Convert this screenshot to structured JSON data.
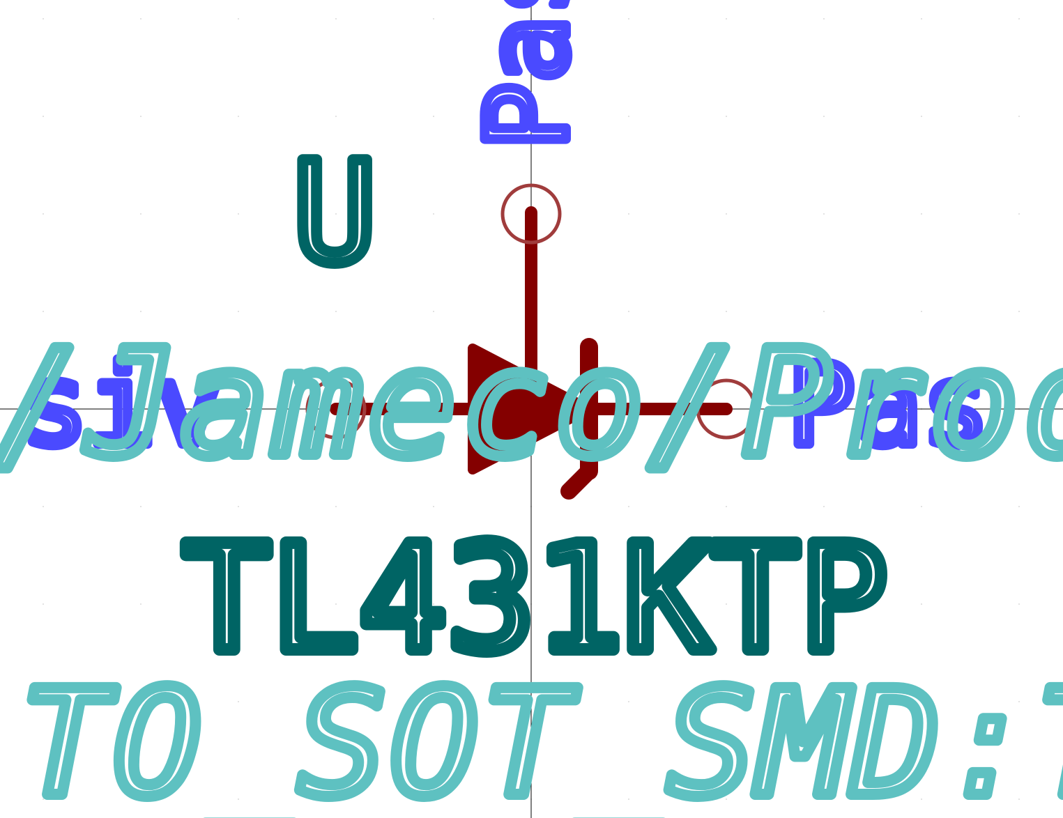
{
  "symbol": {
    "reference": "U",
    "value": "TL431KTP",
    "footprint": "TO_SOT_SMD:TO",
    "datasheet": "/Jameco/Prodi",
    "pins": [
      {
        "name": "Pas",
        "type": "passive",
        "side": "top"
      },
      {
        "name": "siv",
        "type": "passive",
        "side": "left"
      },
      {
        "name": "Pas",
        "type": "passive",
        "side": "right"
      }
    ]
  },
  "colors": {
    "background": "#ffffff",
    "body": "#840000",
    "pin_marker": "#a03c3c",
    "pin_text": "#4a4aff",
    "reference_text": "#006464",
    "field_text": "#5ec1c1",
    "crosshair": "#000000"
  }
}
